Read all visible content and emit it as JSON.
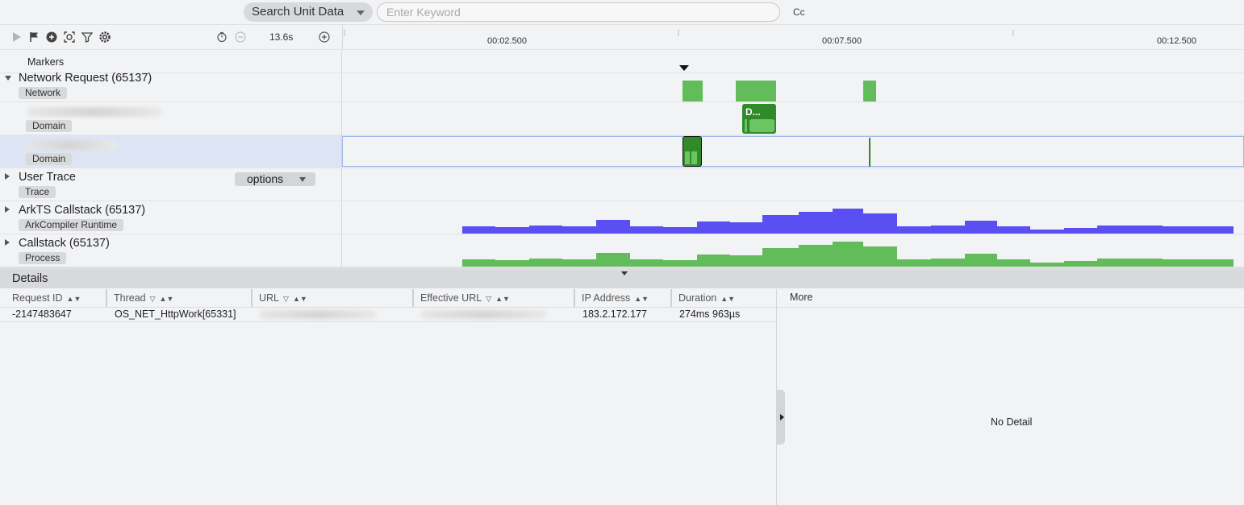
{
  "search": {
    "type_label": "Search Unit Data",
    "placeholder": "Enter Keyword",
    "case_label": "Cc"
  },
  "toolbar": {
    "icons": [
      "play-icon",
      "flag-icon",
      "target-icon",
      "capture-icon",
      "filter-icon",
      "settings-icon",
      "reset-zoom-icon",
      "zoom-out-icon",
      "zoom-in-icon"
    ],
    "zoom_label": "13.6s"
  },
  "ruler": {
    "ticks": [
      "00:02.500",
      "00:07.500",
      "00:12.500"
    ]
  },
  "rows": {
    "markers": {
      "title": "Markers"
    },
    "network": {
      "title": "Network Request (65137)",
      "tag": "Network"
    },
    "domain1": {
      "tag": "Domain",
      "slice_label": "D..."
    },
    "domain2": {
      "tag": "Domain"
    },
    "user_trace": {
      "title": "User Trace",
      "tag": "Trace",
      "options_label": "options"
    },
    "arkts": {
      "title": "ArkTS Callstack (65137)",
      "tag": "ArkCompiler Runtime"
    },
    "callstack": {
      "title": "Callstack (65137)",
      "tag": "Process"
    }
  },
  "colors": {
    "network_bar": "#62bc5a",
    "selected_bar": "#2f8a2a",
    "arkts_area": "#5a4ff2",
    "callstack_area": "#62bc5a",
    "selection_border": "#9db9e8",
    "selection_fill": "#dde5f4"
  },
  "details": {
    "title": "Details",
    "columns": [
      "Request ID",
      "Thread",
      "URL",
      "Effective URL",
      "IP Address",
      "Duration"
    ],
    "rows": [
      {
        "request_id": "-2147483647",
        "thread": "OS_NET_HttpWork[65331]",
        "ip": "183.2.172.177",
        "duration": "274ms 963µs"
      }
    ],
    "more_label": "More",
    "no_detail": "No Detail"
  }
}
